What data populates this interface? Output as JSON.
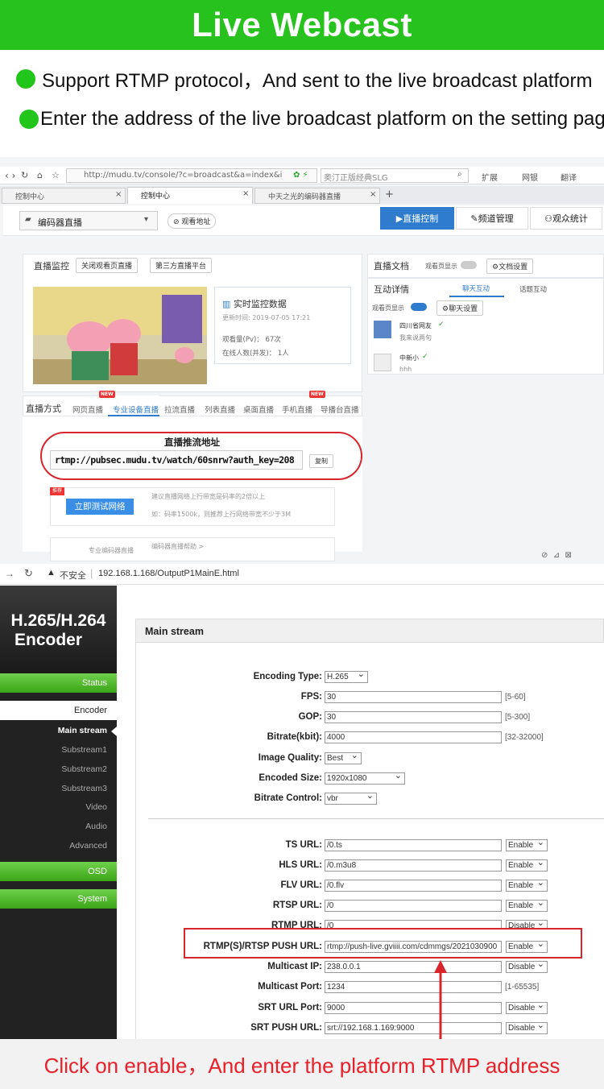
{
  "banner": {
    "title": "Live Webcast"
  },
  "bullets": [
    "Support RTMP protocol，And sent to the live broadcast platform",
    "Enter the address of the live broadcast platform on the setting page"
  ],
  "top_browser": {
    "url": "http://mudu.tv/console/?c=broadcast&a=index&i",
    "search_text": "奥汀正版经典SLG",
    "toolbar_right": [
      "扩展",
      "网银",
      "翻译"
    ],
    "tabs": [
      "控制中心",
      "控制中心",
      "中天之光的编码器直播"
    ],
    "channel_select": "编码器直播",
    "watch_link": "观看地址",
    "nav": [
      "直播控制",
      "频道管理",
      "观众统计"
    ],
    "monitor": {
      "title": "直播监控",
      "btn1": "关闭观看页直播",
      "btn2": "第三方直播平台",
      "realtime_title": "实时监控数据",
      "update_time": "更新时间: 2019-07-05 17:21",
      "views": "观看量(Pv)：  67次",
      "online": "在线人数(并发)：  1人"
    },
    "docs": {
      "title": "直播文档",
      "toggle": "观看页显示",
      "btn": "文档设置"
    },
    "interact": {
      "title": "互动详情",
      "tab1": "聊天互动",
      "tab2": "话题互动",
      "show": "观看页显示",
      "btn": "聊天设置",
      "msg1_user": "四川省网友",
      "msg1_text": "我来说两句",
      "msg2_user": "中新小",
      "msg2_text": "hhh"
    },
    "modes": {
      "label": "直播方式",
      "tabs": [
        "网页直播",
        "专业设备直播",
        "拉流直播",
        "列表直播",
        "桌面直播",
        "手机直播",
        "导播台直播"
      ],
      "new": "NEW"
    },
    "push": {
      "title": "直播推流地址",
      "url": "rtmp://pubsec.mudu.tv/watch/60snrw?auth_key=208",
      "copy": "复制"
    },
    "test": {
      "badge": "推荐",
      "btn": "立即测试网络",
      "tip1": "建议直播网络上行带宽是码率的2倍以上",
      "tip2": "如：码率1500k，则推荐上行网络带宽不少于3M"
    },
    "encoder_help": {
      "label": "专业编码器直播",
      "text": "编码器直播帮助 >"
    }
  },
  "encoder_page": {
    "warning": "不安全",
    "url": "192.168.1.168/OutputP1MainE.html",
    "brand_line1": "H.265/H.264",
    "brand_line2": "Encoder",
    "sidebar": {
      "status": "Status",
      "encoder": "Encoder",
      "main": "Main stream",
      "sub1": "Substream1",
      "sub2": "Substream2",
      "sub3": "Substream3",
      "video": "Video",
      "audio": "Audio",
      "advanced": "Advanced",
      "osd": "OSD",
      "system": "System"
    },
    "section_title": "Main stream",
    "fields": {
      "encoding_type": {
        "label": "Encoding Type:",
        "value": "H.265"
      },
      "fps": {
        "label": "FPS:",
        "value": "30",
        "range": "[5-60]"
      },
      "gop": {
        "label": "GOP:",
        "value": "30",
        "range": "[5-300]"
      },
      "bitrate": {
        "label": "Bitrate(kbit):",
        "value": "4000",
        "range": "[32-32000]"
      },
      "quality": {
        "label": "Image Quality:",
        "value": "Best"
      },
      "size": {
        "label": "Encoded Size:",
        "value": "1920x1080"
      },
      "control": {
        "label": "Bitrate Control:",
        "value": "vbr"
      }
    },
    "urls": {
      "ts": {
        "label": "TS URL:",
        "value": "/0.ts",
        "state": "Enable"
      },
      "hls": {
        "label": "HLS URL:",
        "value": "/0.m3u8",
        "state": "Enable"
      },
      "flv": {
        "label": "FLV URL:",
        "value": "/0.flv",
        "state": "Enable"
      },
      "rtsp": {
        "label": "RTSP URL:",
        "value": "/0",
        "state": "Enable"
      },
      "rtmp": {
        "label": "RTMP URL:",
        "value": "/0",
        "state": "Disable"
      },
      "push": {
        "label": "RTMP(S)/RTSP PUSH URL:",
        "value": "rtmp://push-live.gviiii.com/cdmmgs/2021030900",
        "state": "Enable"
      },
      "mip": {
        "label": "Multicast IP:",
        "value": "238.0.0.1",
        "state": "Disable"
      },
      "mport": {
        "label": "Multicast Port:",
        "value": "1234",
        "range": "[1-65535]"
      },
      "srtport": {
        "label": "SRT URL Port:",
        "value": "9000",
        "state": "Disable"
      },
      "srtpush": {
        "label": "SRT PUSH URL:",
        "value": "srt://192.168.1.169:9000",
        "state": "Disable"
      }
    }
  },
  "caption": "Click on enable，And enter the platform RTMP address",
  "colors": {
    "banner": "#27c21e",
    "highlight": "#d8262b",
    "nav_active": "#2f7ccf",
    "sidebar_green": "#4ab022"
  }
}
